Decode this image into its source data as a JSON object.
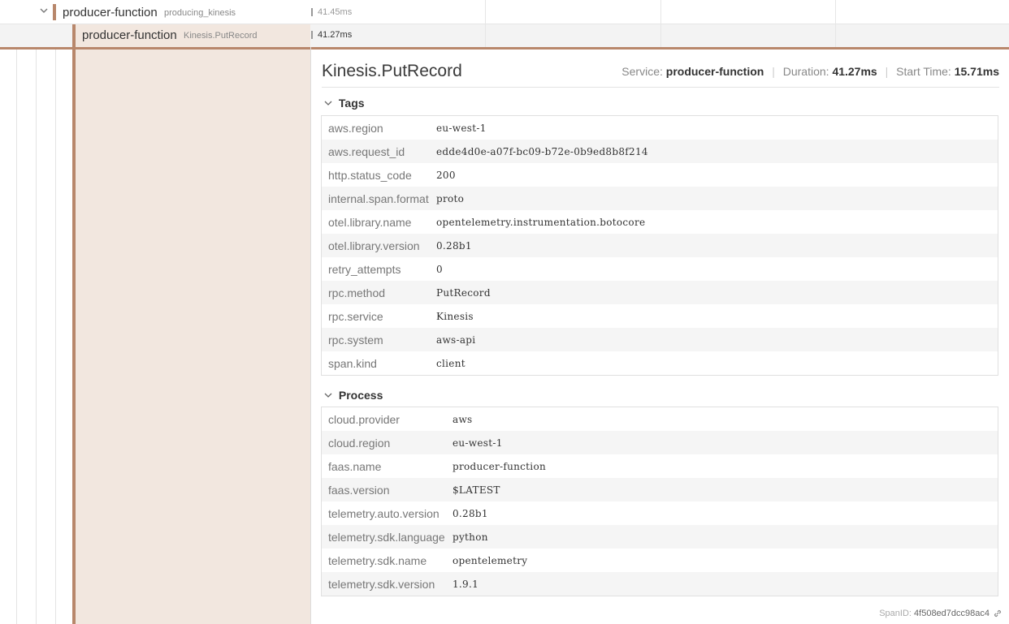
{
  "trace_rows": [
    {
      "service": "producer-function",
      "operation": "producing_kinesis",
      "duration": "41.45ms"
    },
    {
      "service": "producer-function",
      "operation": "Kinesis.PutRecord",
      "duration": "41.27ms"
    }
  ],
  "detail": {
    "title": "Kinesis.PutRecord",
    "service_label": "Service:",
    "service_value": "producer-function",
    "duration_label": "Duration:",
    "duration_value": "41.27ms",
    "start_label": "Start Time:",
    "start_value": "15.71ms"
  },
  "tags": {
    "heading": "Tags",
    "rows": [
      {
        "key": "aws.region",
        "value": "eu-west-1"
      },
      {
        "key": "aws.request_id",
        "value": "edde4d0e-a07f-bc09-b72e-0b9ed8b8f214"
      },
      {
        "key": "http.status_code",
        "value": "200"
      },
      {
        "key": "internal.span.format",
        "value": "proto"
      },
      {
        "key": "otel.library.name",
        "value": "opentelemetry.instrumentation.botocore"
      },
      {
        "key": "otel.library.version",
        "value": "0.28b1"
      },
      {
        "key": "retry_attempts",
        "value": "0"
      },
      {
        "key": "rpc.method",
        "value": "PutRecord"
      },
      {
        "key": "rpc.service",
        "value": "Kinesis"
      },
      {
        "key": "rpc.system",
        "value": "aws-api"
      },
      {
        "key": "span.kind",
        "value": "client"
      }
    ]
  },
  "process": {
    "heading": "Process",
    "rows": [
      {
        "key": "cloud.provider",
        "value": "aws"
      },
      {
        "key": "cloud.region",
        "value": "eu-west-1"
      },
      {
        "key": "faas.name",
        "value": "producer-function"
      },
      {
        "key": "faas.version",
        "value": "$LATEST"
      },
      {
        "key": "telemetry.auto.version",
        "value": "0.28b1"
      },
      {
        "key": "telemetry.sdk.language",
        "value": "python"
      },
      {
        "key": "telemetry.sdk.name",
        "value": "opentelemetry"
      },
      {
        "key": "telemetry.sdk.version",
        "value": "1.9.1"
      }
    ]
  },
  "span_id": {
    "label": "SpanID:",
    "value": "4f508ed7dcc98ac4"
  },
  "icons": {
    "expand": "chevron-down-icon",
    "link": "link-icon"
  },
  "colors": {
    "service": "#b8876b",
    "panel": "#f2e7df"
  }
}
